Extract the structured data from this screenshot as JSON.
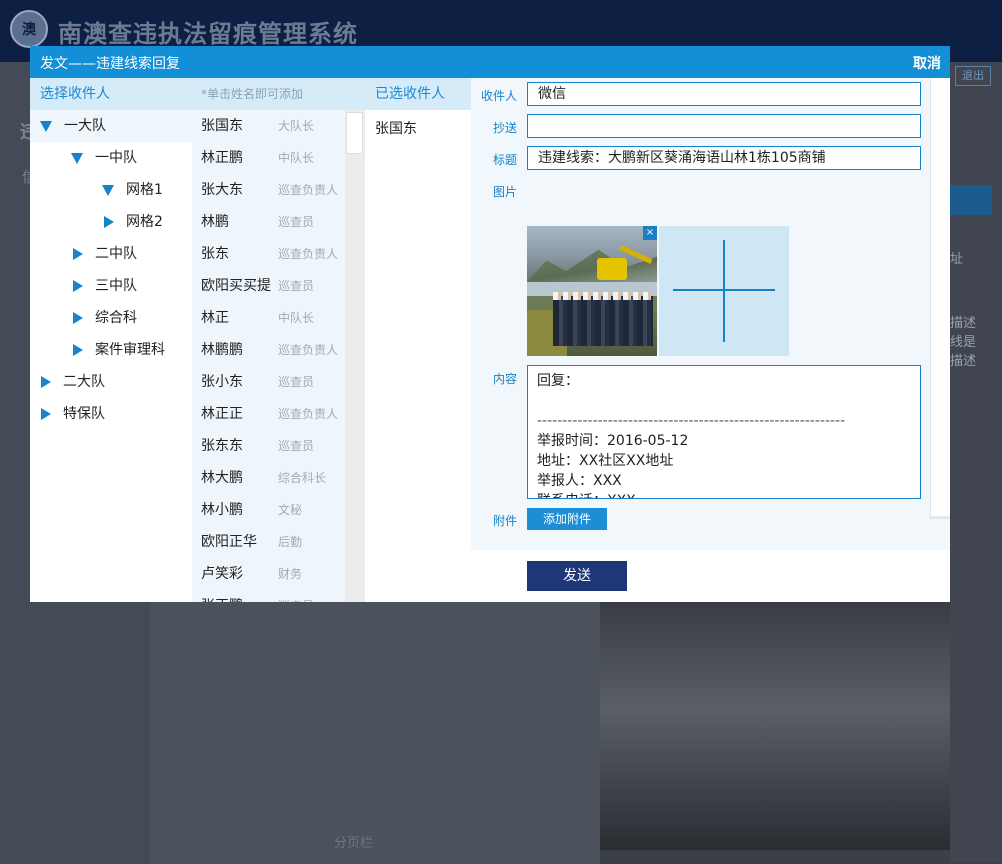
{
  "app": {
    "logo_text": "澳",
    "title": "南澳查违执法留痕管理系统",
    "exit_label": "退出",
    "bg_tab_fragment": "违",
    "bg_side_fragment": "信",
    "pager_label": "分页栏",
    "bg_right_texts": [
      "址",
      "描述",
      "线是",
      "描述"
    ]
  },
  "modal": {
    "title": "发文——违建线索回复",
    "cancel_label": "取消",
    "recipients_header": "选择收件人",
    "hint": "*单击姓名即可添加",
    "selected_header": "已选收件人"
  },
  "tree": [
    {
      "label": "一大队",
      "expanded": true,
      "level": 0
    },
    {
      "label": "一中队",
      "expanded": true,
      "level": 1
    },
    {
      "label": "网格1",
      "expanded": true,
      "level": 2
    },
    {
      "label": "网格2",
      "expanded": false,
      "level": 2
    },
    {
      "label": "二中队",
      "expanded": false,
      "level": 1
    },
    {
      "label": "三中队",
      "expanded": false,
      "level": 1
    },
    {
      "label": "综合科",
      "expanded": false,
      "level": 1
    },
    {
      "label": "案件审理科",
      "expanded": false,
      "level": 1
    },
    {
      "label": "二大队",
      "expanded": false,
      "level": 0
    },
    {
      "label": "特保队",
      "expanded": false,
      "level": 0
    }
  ],
  "people": [
    {
      "name": "张国东",
      "role": "大队长"
    },
    {
      "name": "林正鹏",
      "role": "中队长"
    },
    {
      "name": "张大东",
      "role": "巡查负责人"
    },
    {
      "name": "林鹏",
      "role": "巡查员"
    },
    {
      "name": "张东",
      "role": "巡查负责人"
    },
    {
      "name": "欧阳买买提",
      "role": "巡查员"
    },
    {
      "name": "林正",
      "role": "中队长"
    },
    {
      "name": "林鹏鹏",
      "role": "巡查负责人"
    },
    {
      "name": "张小东",
      "role": "巡查员"
    },
    {
      "name": "林正正",
      "role": "巡查负责人"
    },
    {
      "name": "张东东",
      "role": "巡查员"
    },
    {
      "name": "林大鹏",
      "role": "综合科长"
    },
    {
      "name": "林小鹏",
      "role": "文秘"
    },
    {
      "name": "欧阳正华",
      "role": "后勤"
    },
    {
      "name": "卢笑彩",
      "role": "财务"
    },
    {
      "name": "张正鹏",
      "role": "巡查员"
    }
  ],
  "selected": [
    "张国东"
  ],
  "form": {
    "to_label": "收件人",
    "to_value": "微信",
    "cc_label": "抄送",
    "cc_value": "",
    "subject_label": "标题",
    "subject_value": "违建线索：大鹏新区葵涌海语山林1栋105商铺",
    "image_label": "图片",
    "content_label": "内容",
    "content_lines": [
      "回复：",
      "",
      "-------------------------------------------------------------",
      "举报时间：2016-05-12",
      "地址：XX社区XX地址",
      "举报人：XXX",
      "联系电话：XXX"
    ],
    "attach_label": "附件",
    "attach_button": "添加附件",
    "close_glyph": "×"
  },
  "send_label": "发送",
  "colors": {
    "header_blue": "#138fd7",
    "accent_blue": "#1483ca",
    "send_navy": "#1d3777",
    "app_header": "#0e1f44"
  }
}
